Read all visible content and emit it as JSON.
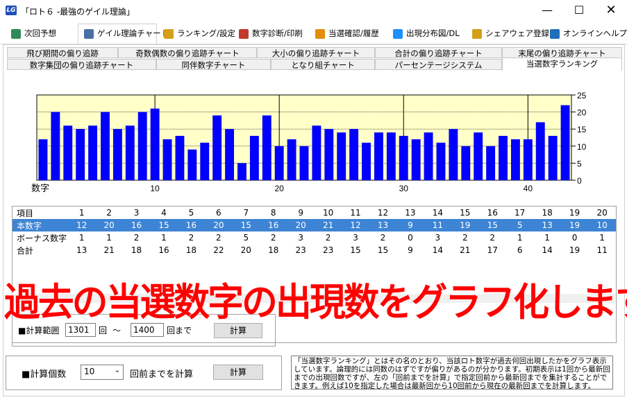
{
  "window": {
    "title": "「ロト６ -最強のゲイル理論」",
    "app_icon": "LG"
  },
  "toolbar": {
    "tabs": [
      {
        "label": "次回予想",
        "icon": "leaf-icon",
        "color": "#2e8b57"
      },
      {
        "label": "ゲイル理論チャート",
        "icon": "notebook-icon",
        "color": "#4a6fa5"
      },
      {
        "label": "ランキング/設定",
        "icon": "bar-chart-icon",
        "color": "#d4a017"
      },
      {
        "label": "数字診断/印刷",
        "icon": "gear-icon",
        "color": "#c0392b"
      },
      {
        "label": "当選確認/履歴",
        "icon": "people-icon",
        "color": "#e08e0b"
      },
      {
        "label": "出現分布図/DL",
        "icon": "document-icon",
        "color": "#1e90ff"
      },
      {
        "label": "シェアウェア登録",
        "icon": "lock-icon",
        "color": "#d4a017"
      },
      {
        "label": "オンラインヘルプ",
        "icon": "help-icon",
        "color": "#1f6fb8"
      }
    ]
  },
  "subtabs": {
    "row1": [
      "飛び期間の偏り追跡",
      "奇数偶数の偏り追跡チャート",
      "大小の偏り追跡チャート",
      "合計の偏り追跡チャート",
      "末尾の偏り追跡チャート"
    ],
    "row2": [
      "数字集団の偏り追跡チャート",
      "同伴数字チャート",
      "となり組チャート",
      "パーセンテージシステム",
      "当選数字ランキング"
    ]
  },
  "chart_data": {
    "type": "bar",
    "xlabel": "数字",
    "x_ticks": [
      10,
      20,
      30,
      40
    ],
    "y_ticks": [
      0,
      5,
      10,
      15,
      20,
      25
    ],
    "ylim": [
      0,
      25
    ],
    "categories": [
      1,
      2,
      3,
      4,
      5,
      6,
      7,
      8,
      9,
      10,
      11,
      12,
      13,
      14,
      15,
      16,
      17,
      18,
      19,
      20,
      21,
      22,
      23,
      24,
      25,
      26,
      27,
      28,
      29,
      30,
      31,
      32,
      33,
      34,
      35,
      36,
      37,
      38,
      39,
      40,
      41,
      42,
      43
    ],
    "values": [
      12,
      20,
      16,
      15,
      16,
      20,
      15,
      16,
      20,
      21,
      12,
      13,
      9,
      11,
      19,
      15,
      5,
      13,
      19,
      10,
      12,
      10,
      16,
      15,
      14,
      15,
      11,
      14,
      14,
      13,
      12,
      14,
      11,
      15,
      10,
      14,
      10,
      13,
      12,
      12,
      17,
      13,
      22
    ],
    "bar_color": "#0000ff",
    "plot_bg": "#ffffc8"
  },
  "grid": {
    "header_label": "項目",
    "columns": [
      1,
      2,
      3,
      4,
      5,
      6,
      7,
      8,
      9,
      10,
      11,
      12,
      13,
      14,
      15,
      16,
      17,
      18,
      19,
      20
    ],
    "rows": [
      {
        "label": "本数字",
        "values": [
          12,
          20,
          16,
          15,
          16,
          20,
          15,
          16,
          20,
          21,
          12,
          13,
          9,
          11,
          19,
          15,
          5,
          13,
          19,
          10
        ]
      },
      {
        "label": "ボーナス数字",
        "values": [
          1,
          1,
          2,
          1,
          2,
          2,
          5,
          2,
          3,
          2,
          3,
          2,
          0,
          3,
          2,
          2,
          1,
          1,
          0,
          1
        ]
      },
      {
        "label": "合計",
        "values": [
          13,
          21,
          18,
          16,
          18,
          22,
          20,
          18,
          23,
          23,
          15,
          15,
          9,
          14,
          21,
          17,
          6,
          14,
          19,
          11
        ]
      }
    ]
  },
  "overlay_text": "過去の当選数字の出現数をグラフ化します",
  "range_group": {
    "label": "■計算範囲",
    "from": "1301",
    "from_suffix": "回",
    "tilde": "〜",
    "to": "1400",
    "to_suffix": "回まで",
    "button": "計算"
  },
  "count_group": {
    "label": "■計算個数",
    "value": "10",
    "suffix": "回前までを計算",
    "button": "計算"
  },
  "description": "「当選数字ランキング」とはその名のとおり、当該ロト数字が過去何回出現したかをグラフ表示しています。論理的には同数のはずですが偏りがあるのが分かります。初期表示は1回から最新回までの出現回数ですが、左の「回前までを計算」で指定回前から最新回までを集計することができます。例えば10を指定した場合は最新回から10回前から現在の最新回までを計算します。"
}
